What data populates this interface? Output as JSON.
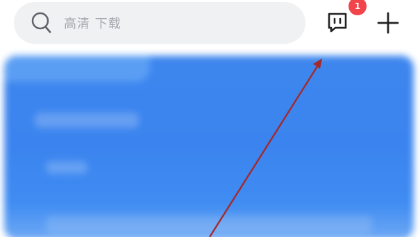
{
  "search": {
    "placeholder": "高清 下载",
    "icon": "search-icon"
  },
  "header": {
    "messages": {
      "icon": "message-icon",
      "badge_count": "1",
      "badge_color": "#f2444b"
    },
    "add": {
      "icon": "plus-icon"
    }
  },
  "banner": {
    "color": "#3d86ee"
  },
  "annotation": {
    "icon": "arrow-annotation",
    "color": "#a32a2a"
  }
}
